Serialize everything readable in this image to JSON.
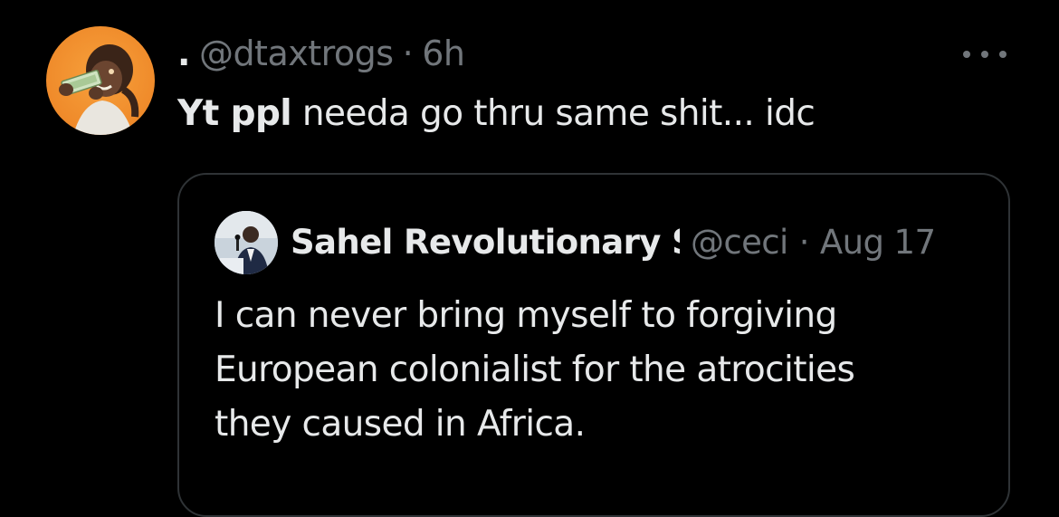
{
  "tweet": {
    "avatar_icon": "user-avatar-cartoon",
    "display_name": ".",
    "handle": "@dtaxtrogs",
    "separator": "·",
    "time": "6h",
    "more_icon": "more-options-icon",
    "text_bold": "Yt ppl",
    "text_rest": " needa go thru same shit... idc"
  },
  "quote": {
    "avatar_icon": "user-avatar-photo",
    "display_name": "Sahel Revolutionary S",
    "handle": "@ceci",
    "separator": "·",
    "date": "Aug 17",
    "text_lines": [
      "I can never bring myself to forgiving",
      "European colonialist for the atrocities",
      "they caused in Africa."
    ]
  },
  "colors": {
    "background": "#000000",
    "primary_text": "#e7e9ea",
    "secondary_text": "#71767b",
    "border": "#2f3336",
    "avatar_bg": "#ef8a2a"
  }
}
